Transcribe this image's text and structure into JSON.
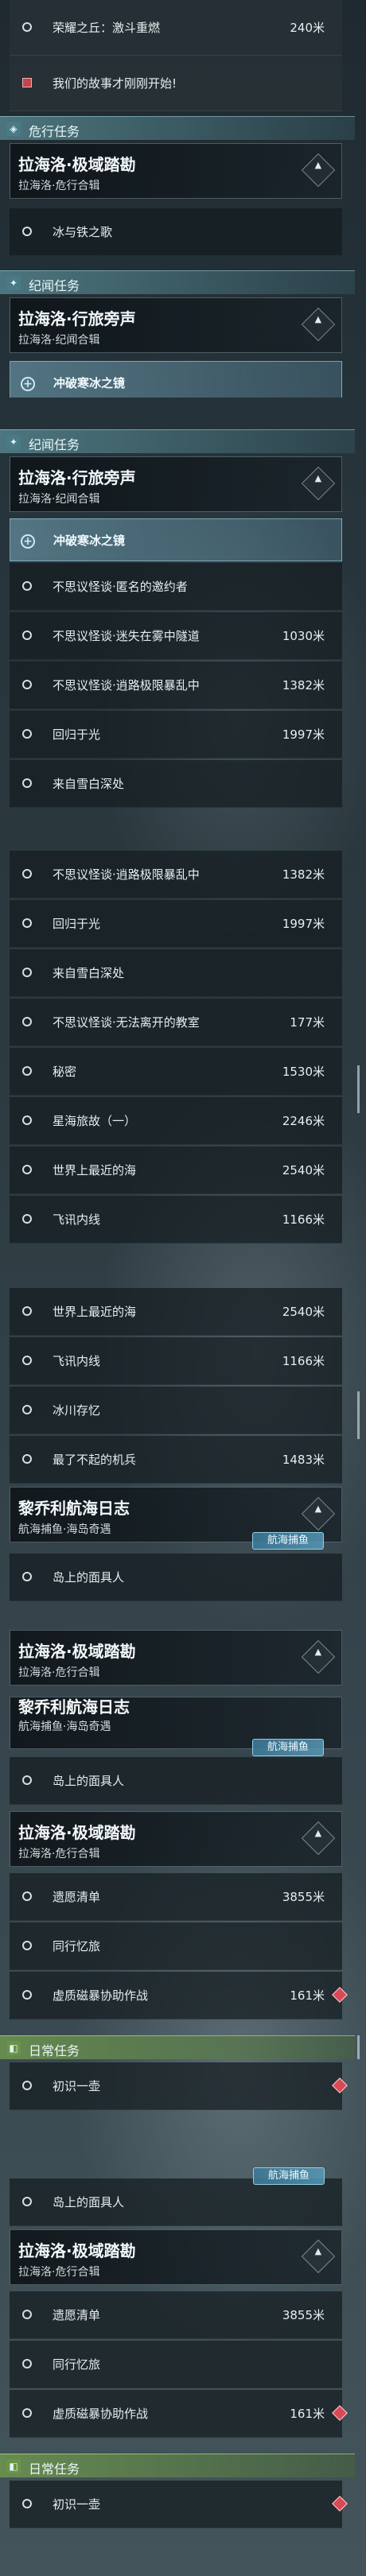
{
  "top_entries": [
    {
      "label": "荣耀之丘：激斗重燃",
      "dist": "240米"
    },
    {
      "label": "我们的故事才刚刚开始!",
      "dist": ""
    }
  ],
  "headers": {
    "danger": "危行任务",
    "record": "纪闻任务",
    "daily": "日常任务"
  },
  "cards": {
    "latial_danger": {
      "title": "拉海洛·极域踏勘",
      "sub": "拉海洛·危行合辑"
    },
    "latial_record": {
      "title": "拉海洛·行旅旁声",
      "sub": "拉海洛·纪闻合辑"
    },
    "latial_danger_b": {
      "title": "拉海洛·极域踏勘",
      "sub": "拉海洛·危行合辑"
    },
    "lichiao": {
      "title": "黎乔利航海日志",
      "sub": "航海捕鱼·海岛奇遇"
    },
    "lichiao_partial": {
      "title": "黎乔利航海日志",
      "sub": "航海捕鱼·海岛奇遇"
    }
  },
  "tag": "航海捕鱼",
  "quests": {
    "ice_song": "冰与铁之歌",
    "break_ice": "冲破寒冰之镜",
    "bizarre_invite": "不思议怪谈·匿名的邀约者",
    "bizarre_tunnel": "不思议怪谈·迷失在雾中隧道",
    "bizarre_storm": "不思议怪谈·逍路极限暴乱中",
    "back_to_light": "回归于光",
    "from_white": "来自雪白深处",
    "bizarre_class": "不思议怪谈·无法离开的教室",
    "secret": "秘密",
    "stars": "星海旅故（一）",
    "nearest_sea": "世界上最近的海",
    "flight": "飞讯内线",
    "glacier": "冰川存忆",
    "bold": "最了不起的机兵",
    "islander": "岛上的面具人",
    "wish": "遗愿清单",
    "companion": "同行忆旅",
    "rescue": "虚质磁暴协助作战",
    "first": "初识一壶"
  },
  "dists": {
    "tunnel": "1030米",
    "storm": "1382米",
    "light": "1997米",
    "class": "177米",
    "secret": "1530米",
    "stars": "2246米",
    "sea": "2540米",
    "flight": "1166米",
    "bold": "1483米",
    "wish": "3855米",
    "rescue": "161米"
  },
  "colors": {
    "accent": "#4a7a86",
    "daily": "#6a9448",
    "warn": "#d94a56"
  }
}
